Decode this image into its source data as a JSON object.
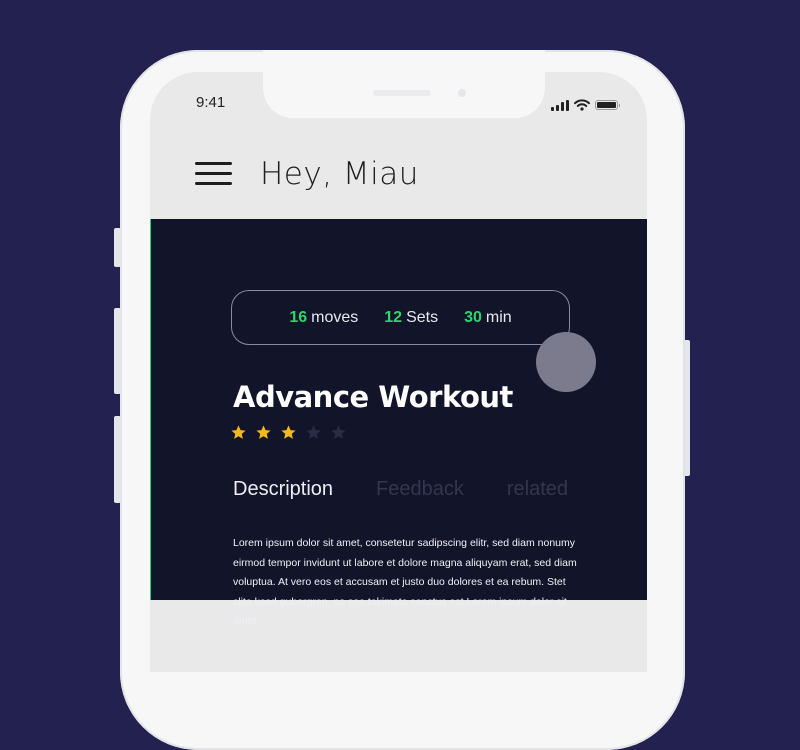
{
  "status_bar": {
    "time": "9:41",
    "icons": [
      "cellular-signal-icon",
      "wifi-icon",
      "battery-icon"
    ]
  },
  "header": {
    "menu_icon": "hamburger-menu-icon",
    "greeting": "Hey, Miau"
  },
  "stats": [
    {
      "value": "16",
      "label": "moves"
    },
    {
      "value": "12",
      "label": "Sets"
    },
    {
      "value": "30",
      "label": "min"
    }
  ],
  "workout": {
    "title": "Advance Workout",
    "rating": 3,
    "rating_max": 5
  },
  "tabs": [
    {
      "label": "Description",
      "active": true
    },
    {
      "label": "Feedback",
      "active": false
    },
    {
      "label": "related",
      "active": false
    }
  ],
  "description": "Lorem ipsum dolor sit amet, consetetur sadipscing elitr, sed diam nonumy eirmod tempor invidunt ut labore et dolore magna aliquyam erat, sed diam voluptua. At vero eos et accusam et justo duo dolores et ea rebum. Stet clita kasd gubergren, no sea takimata sanctus est Lorem ipsum dolor sit amet.",
  "colors": {
    "background": "#22214f",
    "accent_green": "#2fd46a",
    "star_filled": "#f5b818",
    "star_empty": "#2a2c44",
    "content_bg": "#12142a",
    "header_bg": "#e9e9ea"
  }
}
